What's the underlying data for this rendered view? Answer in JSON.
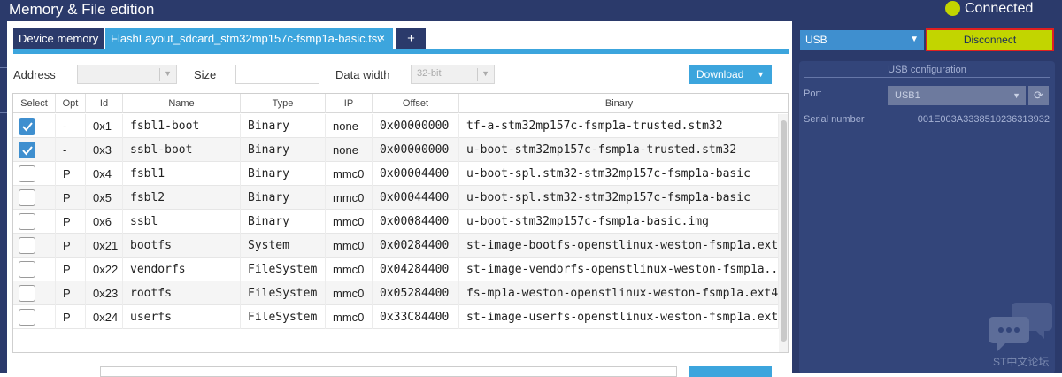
{
  "window": {
    "title": "Memory & File edition",
    "status": "Connected",
    "status_color": "#c2d500"
  },
  "tabs": [
    {
      "label": "Device memory",
      "active": false
    },
    {
      "label": "FlashLayout_sdcard_stm32mp157c-fsmp1a-basic.tsv",
      "active": true,
      "close": "×"
    },
    {
      "label": "+"
    }
  ],
  "toolbar": {
    "address_label": "Address",
    "address_value": "",
    "size_label": "Size",
    "size_value": "",
    "data_width_label": "Data width",
    "data_width_value": "32-bit",
    "download_label": "Download"
  },
  "table": {
    "columns": [
      "Select",
      "Opt",
      "Id",
      "Name",
      "Type",
      "IP",
      "Offset",
      "Binary"
    ],
    "rows": [
      {
        "select": true,
        "opt": "-",
        "id": "0x1",
        "name": "fsbl1-boot",
        "type": "Binary",
        "ip": "none",
        "offset": "0x00000000",
        "binary": "tf-a-stm32mp157c-fsmp1a-trusted.stm32"
      },
      {
        "select": true,
        "opt": "-",
        "id": "0x3",
        "name": "ssbl-boot",
        "type": "Binary",
        "ip": "none",
        "offset": "0x00000000",
        "binary": "u-boot-stm32mp157c-fsmp1a-trusted.stm32"
      },
      {
        "select": false,
        "opt": "P",
        "id": "0x4",
        "name": "fsbl1",
        "type": "Binary",
        "ip": "mmc0",
        "offset": "0x00004400",
        "binary": "u-boot-spl.stm32-stm32mp157c-fsmp1a-basic"
      },
      {
        "select": false,
        "opt": "P",
        "id": "0x5",
        "name": "fsbl2",
        "type": "Binary",
        "ip": "mmc0",
        "offset": "0x00044400",
        "binary": "u-boot-spl.stm32-stm32mp157c-fsmp1a-basic"
      },
      {
        "select": false,
        "opt": "P",
        "id": "0x6",
        "name": "ssbl",
        "type": "Binary",
        "ip": "mmc0",
        "offset": "0x00084400",
        "binary": "u-boot-stm32mp157c-fsmp1a-basic.img"
      },
      {
        "select": false,
        "opt": "P",
        "id": "0x21",
        "name": "bootfs",
        "type": "System",
        "ip": "mmc0",
        "offset": "0x00284400",
        "binary": "st-image-bootfs-openstlinux-weston-fsmp1a.ext"
      },
      {
        "select": false,
        "opt": "P",
        "id": "0x22",
        "name": "vendorfs",
        "type": "FileSystem",
        "ip": "mmc0",
        "offset": "0x04284400",
        "binary": "st-image-vendorfs-openstlinux-weston-fsmp1a.."
      },
      {
        "select": false,
        "opt": "P",
        "id": "0x23",
        "name": "rootfs",
        "type": "FileSystem",
        "ip": "mmc0",
        "offset": "0x05284400",
        "binary": "fs-mp1a-weston-openstlinux-weston-fsmp1a.ext4"
      },
      {
        "select": false,
        "opt": "P",
        "id": "0x24",
        "name": "userfs",
        "type": "FileSystem",
        "ip": "mmc0",
        "offset": "0x33C84400",
        "binary": "st-image-userfs-openstlinux-weston-fsmp1a.ext"
      }
    ]
  },
  "right_panel": {
    "interface": "USB",
    "disconnect_label": "Disconnect",
    "config_title": "USB configuration",
    "port_label": "Port",
    "port_value": "USB1",
    "serial_label": "Serial number",
    "serial_value": "001E003A3338510236313932",
    "watermark": "ST中文论坛"
  },
  "icons": {
    "checkbox_check": "check-icon",
    "refresh": "refresh-icon",
    "chat": "chat-icon"
  }
}
